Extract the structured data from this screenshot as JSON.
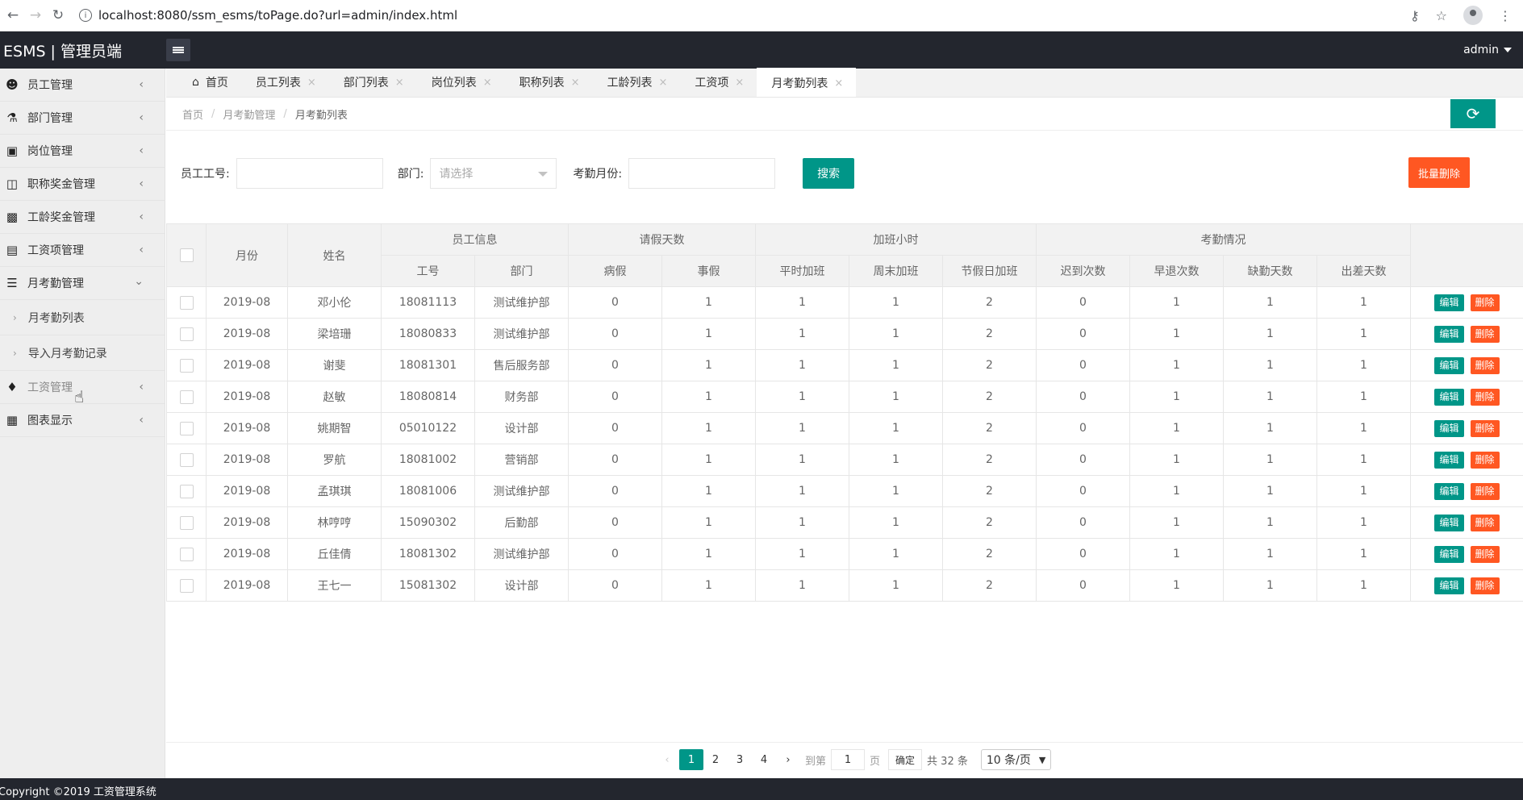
{
  "browser": {
    "url": "localhost:8080/ssm_esms/toPage.do?url=admin/index.html"
  },
  "header": {
    "logo": "ESMS | 管理员端",
    "user": "admin"
  },
  "sidebar": {
    "items": [
      {
        "label": "员工管理",
        "icon": "users-icon"
      },
      {
        "label": "部门管理",
        "icon": "sitemap-icon"
      },
      {
        "label": "岗位管理",
        "icon": "id-card-icon"
      },
      {
        "label": "职称奖金管理",
        "icon": "briefcase-icon"
      },
      {
        "label": "工龄奖金管理",
        "icon": "industry-icon"
      },
      {
        "label": "工资项管理",
        "icon": "newspaper-icon"
      },
      {
        "label": "月考勤管理",
        "icon": "layers-icon"
      }
    ],
    "subitems": [
      {
        "label": "月考勤列表"
      },
      {
        "label": "导入月考勤记录"
      }
    ],
    "items_after": [
      {
        "label": "工资管理",
        "icon": "tag-icon"
      },
      {
        "label": "图表显示",
        "icon": "list-icon"
      }
    ]
  },
  "tabs": [
    {
      "label": "首页"
    },
    {
      "label": "员工列表"
    },
    {
      "label": "部门列表"
    },
    {
      "label": "岗位列表"
    },
    {
      "label": "职称列表"
    },
    {
      "label": "工龄列表"
    },
    {
      "label": "工资项"
    },
    {
      "label": "月考勤列表"
    }
  ],
  "breadcrumb": [
    "首页",
    "月考勤管理",
    "月考勤列表"
  ],
  "search": {
    "emp_no_label": "员工工号:",
    "dept_label": "部门:",
    "dept_placeholder": "请选择",
    "month_label": "考勤月份:",
    "search_btn": "搜索",
    "batch_delete_btn": "批量删除"
  },
  "table": {
    "group_headers": {
      "month": "月份",
      "name": "姓名",
      "emp_info": "员工信息",
      "leave": "请假天数",
      "overtime": "加班小时",
      "attendance": "考勤情况"
    },
    "sub_headers": [
      "工号",
      "部门",
      "病假",
      "事假",
      "平时加班",
      "周末加班",
      "节假日加班",
      "迟到次数",
      "早退次数",
      "缺勤天数",
      "出差天数"
    ],
    "edit_label": "编辑",
    "delete_label": "删除",
    "rows": [
      [
        "2019-08",
        "邓小伦",
        "18081113",
        "测试维护部",
        "0",
        "1",
        "1",
        "1",
        "2",
        "0",
        "1",
        "1",
        "1"
      ],
      [
        "2019-08",
        "梁培珊",
        "18080833",
        "测试维护部",
        "0",
        "1",
        "1",
        "1",
        "2",
        "0",
        "1",
        "1",
        "1"
      ],
      [
        "2019-08",
        "谢斐",
        "18081301",
        "售后服务部",
        "0",
        "1",
        "1",
        "1",
        "2",
        "0",
        "1",
        "1",
        "1"
      ],
      [
        "2019-08",
        "赵敏",
        "18080814",
        "财务部",
        "0",
        "1",
        "1",
        "1",
        "2",
        "0",
        "1",
        "1",
        "1"
      ],
      [
        "2019-08",
        "姚期智",
        "05010122",
        "设计部",
        "0",
        "1",
        "1",
        "1",
        "2",
        "0",
        "1",
        "1",
        "1"
      ],
      [
        "2019-08",
        "罗航",
        "18081002",
        "营销部",
        "0",
        "1",
        "1",
        "1",
        "2",
        "0",
        "1",
        "1",
        "1"
      ],
      [
        "2019-08",
        "孟琪琪",
        "18081006",
        "测试维护部",
        "0",
        "1",
        "1",
        "1",
        "2",
        "0",
        "1",
        "1",
        "1"
      ],
      [
        "2019-08",
        "林哼哼",
        "15090302",
        "后勤部",
        "0",
        "1",
        "1",
        "1",
        "2",
        "0",
        "1",
        "1",
        "1"
      ],
      [
        "2019-08",
        "丘佳倩",
        "18081302",
        "测试维护部",
        "0",
        "1",
        "1",
        "1",
        "2",
        "0",
        "1",
        "1",
        "1"
      ],
      [
        "2019-08",
        "王七一",
        "15081302",
        "设计部",
        "0",
        "1",
        "1",
        "1",
        "2",
        "0",
        "1",
        "1",
        "1"
      ]
    ]
  },
  "pagination": {
    "pages": [
      "1",
      "2",
      "3",
      "4"
    ],
    "goto_label": "到第",
    "goto_value": "1",
    "page_unit": "页",
    "confirm": "确定",
    "total": "共 32 条",
    "page_size": "10 条/页"
  },
  "footer": {
    "copyright": "Copyright ©2019 工资管理系统"
  },
  "colors": {
    "primary": "#009688",
    "danger": "#ff5722",
    "header_bg": "#23262e"
  }
}
